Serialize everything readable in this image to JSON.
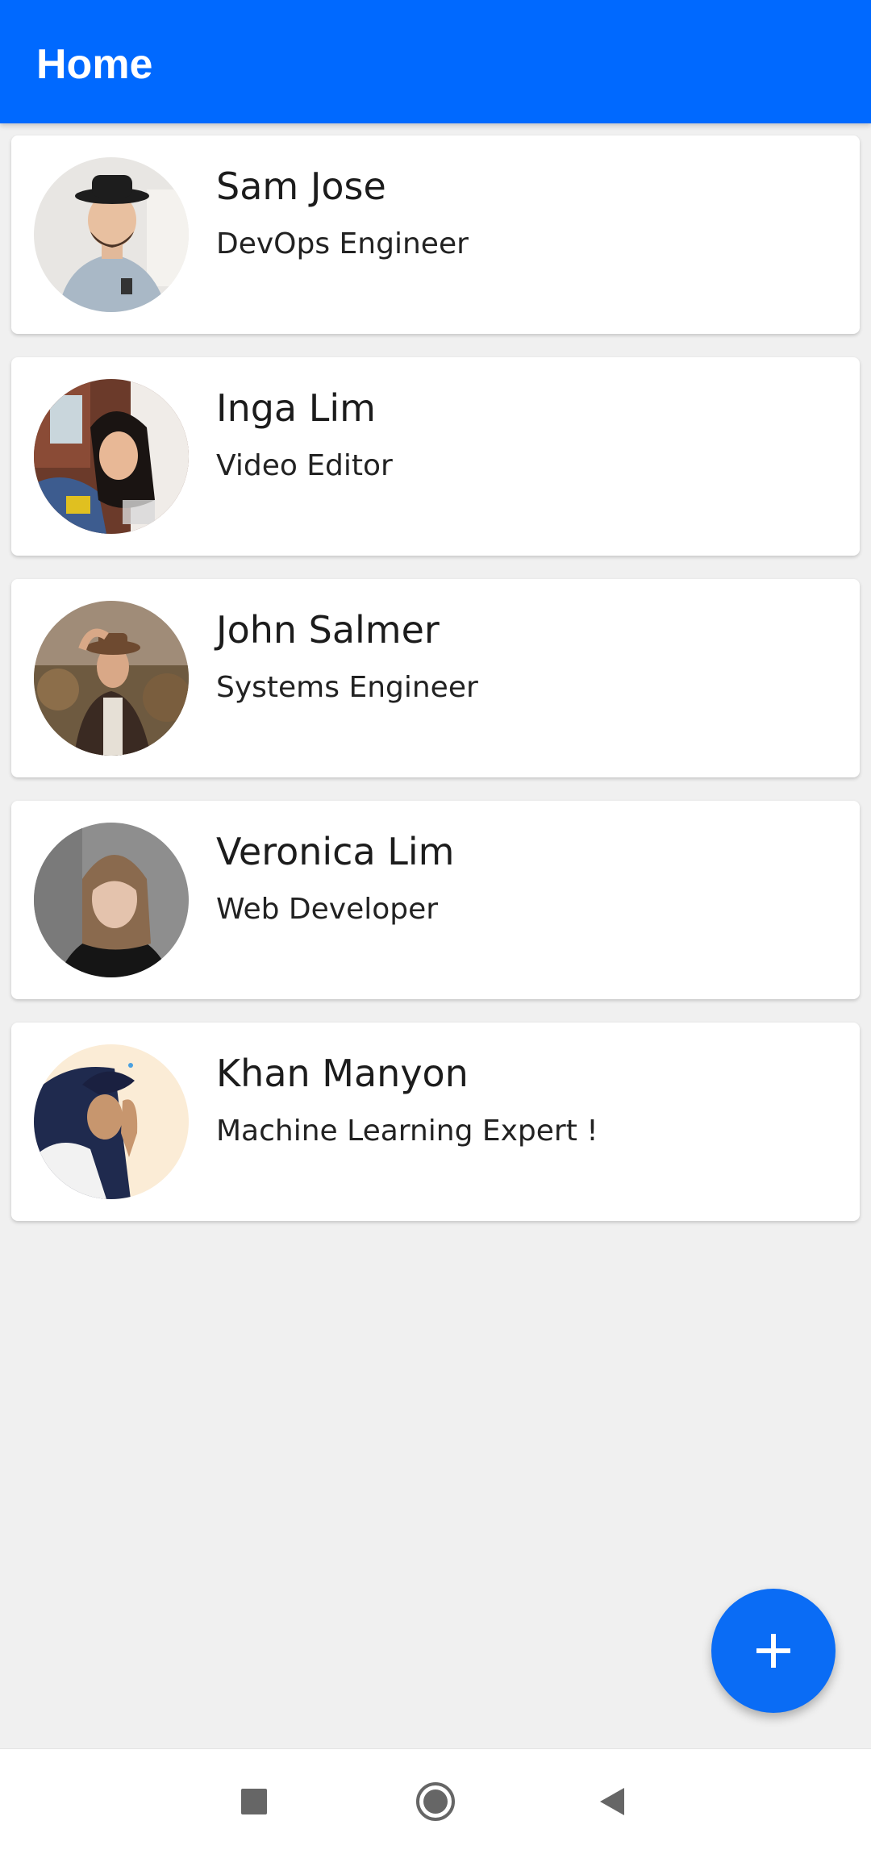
{
  "appbar": {
    "title": "Home",
    "color": "#0069ff"
  },
  "contacts": [
    {
      "name": "Sam Jose",
      "role": "DevOps Engineer",
      "avatar_icon": "avatar-photo"
    },
    {
      "name": "Inga Lim",
      "role": "Video Editor",
      "avatar_icon": "avatar-photo"
    },
    {
      "name": "John Salmer",
      "role": "Systems Engineer",
      "avatar_icon": "avatar-photo"
    },
    {
      "name": "Veronica Lim",
      "role": "Web Developer",
      "avatar_icon": "avatar-photo"
    },
    {
      "name": "Khan Manyon",
      "role": "Machine Learning Expert !",
      "avatar_icon": "avatar-photo"
    }
  ],
  "fab": {
    "icon": "plus-icon",
    "color": "#0a6cf5"
  },
  "navigation_bar": {
    "buttons": [
      {
        "icon": "recents-square-icon"
      },
      {
        "icon": "home-circle-icon"
      },
      {
        "icon": "back-triangle-icon"
      }
    ]
  }
}
